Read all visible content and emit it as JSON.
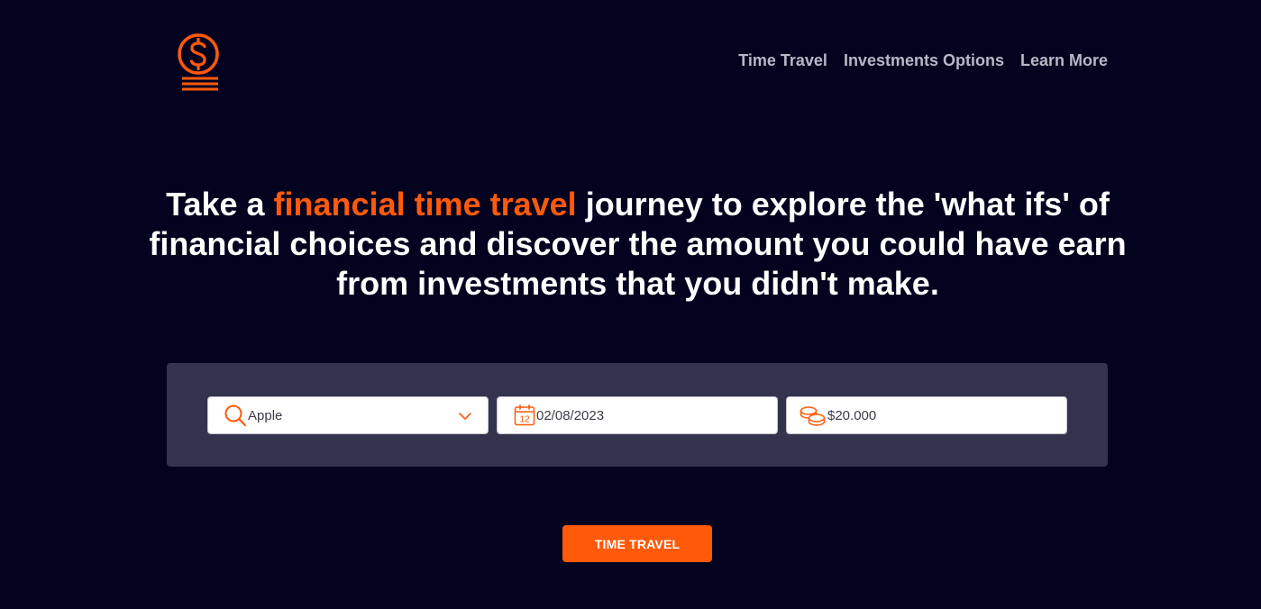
{
  "brand": {
    "logo_icon": "dollar-coin-stack-icon",
    "accent_color": "#ff5a0a",
    "background_color": "#03021f"
  },
  "nav": {
    "items": [
      {
        "label": "Time Travel"
      },
      {
        "label": "Investments Options"
      },
      {
        "label": "Learn More"
      }
    ]
  },
  "hero": {
    "text_before": "Take a ",
    "highlight": "financial time travel",
    "text_after": " journey to explore the 'what ifs' of financial choices and discover the amount you could have earn from investments that you didn't make."
  },
  "form": {
    "company": {
      "icon": "search-icon",
      "value": "Apple",
      "dropdown_icon": "chevron-down-icon"
    },
    "date": {
      "icon": "calendar-icon",
      "calendar_day": "12",
      "value": "02/08/2023"
    },
    "amount": {
      "icon": "coins-icon",
      "value": "$20.000"
    },
    "submit_label": "TIME TRAVEL"
  }
}
